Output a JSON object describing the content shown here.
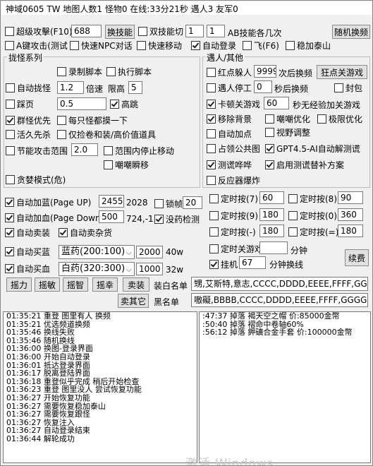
{
  "title": "神域0605 TW 地图人数1 怪物0 在线:33分21秒 遇人3 友军0",
  "top": {
    "super_attack": {
      "label": "超级攻擊(F10)",
      "checked": false,
      "value": "688"
    },
    "skill_btn": "换技能",
    "dual_skill": {
      "label": "双技能切",
      "checked": false,
      "v1": "1",
      "v2": "1"
    },
    "ab_label": "AB技能各几次",
    "random_btn": "随机换频",
    "a_key": {
      "label": "A键攻击(测试",
      "checked": false
    },
    "npc_talk": {
      "label": "快速NPC对话",
      "checked": false
    },
    "fast_move": {
      "label": "快速移动",
      "checked": false
    },
    "auto_login": {
      "label": "自动登录",
      "checked": true
    },
    "fly": {
      "label": "飞(F6)",
      "checked": false
    },
    "taishan": {
      "label": "稳加泰山",
      "checked": false
    }
  },
  "pickup": {
    "group_label": "拢怪系列",
    "record_script": {
      "label": "录制脚本",
      "checked": false
    },
    "run_script": {
      "label": "执行脚本",
      "checked": false
    },
    "auto_gather": {
      "label": "自动拢怪",
      "checked": false,
      "value": "1.2"
    },
    "multiplier": "倍速",
    "limit_high": "限高",
    "limit_value": "5",
    "stomp": {
      "label": "踩页",
      "checked": false,
      "value": "0.5"
    },
    "high_jump": {
      "label": "高跳",
      "checked": true
    },
    "group_first": {
      "label": "群怪优先",
      "checked": true
    },
    "touch_each": {
      "label": "每只怪都摸一下",
      "checked": false
    },
    "live_first": {
      "label": "活久先杀",
      "checked": false
    },
    "only_scroll": {
      "label": "仅捡卷和装/高价值道具",
      "checked": false
    },
    "energy_range": {
      "label": "节能攻击范围",
      "checked": false,
      "value": "2.0"
    },
    "stop_in_range": {
      "label": "范围内停止移动",
      "checked": false
    },
    "dodge": {
      "label": "嘲嘲瞬移",
      "checked": false
    },
    "greedy": {
      "label": "贪婪模式(危)",
      "checked": false
    }
  },
  "encounter": {
    "group_label": "遇人/其他",
    "red_dot": {
      "label": "红点躲人",
      "checked": false,
      "value": "9999"
    },
    "next_change": "次后换频",
    "crazy_btn": "狂点关游戏",
    "meet_stop": {
      "label": "遇人停工",
      "checked": false,
      "value": "0"
    },
    "sec_change": "秒后换频",
    "seal": {
      "label": "封包",
      "checked": false
    },
    "stuck_close": {
      "label": "卡顿关游戏",
      "checked": true,
      "value": "60"
    },
    "no_exp": "秒无经验加关游戏",
    "remove_bg": {
      "label": "移除背景",
      "checked": true
    },
    "dodge_opt": {
      "label": "嘲嘲优化",
      "checked": false
    },
    "extreme_opt": {
      "label": "极限优化",
      "checked": false
    },
    "auto_point": {
      "label": "自动加点",
      "checked": false
    },
    "view_adjust": {
      "label": "视野调整",
      "checked": false
    },
    "public_map": {
      "label": "占领公共图",
      "checked": false
    },
    "gpt": {
      "label": "GPT4.5-AI自动解测谎",
      "checked": true
    },
    "test_alarm": {
      "label": "测谎哗哗",
      "checked": true
    },
    "enable_patch": {
      "label": "启用测谎替补方案",
      "checked": true
    },
    "anti_ban": {
      "label": "反应器爆炸",
      "checked": false
    }
  },
  "auto": {
    "blue": {
      "label": "自动加蓝(Page UP)",
      "checked": true,
      "value": "2455",
      "extra": "2028"
    },
    "red": {
      "label": "自动加血(Page Down)",
      "checked": true,
      "value": "500",
      "extra": "724,-1"
    },
    "lock": {
      "label": "锁帧",
      "checked": false,
      "value": "20"
    },
    "no_check": {
      "label": "没药检测",
      "checked": true
    },
    "sell": {
      "label": "自动卖装",
      "checked": true
    },
    "sell_misc": {
      "label": "自动卖杂货",
      "checked": true
    },
    "buy_blue": {
      "label": "自动买蓝",
      "checked": true,
      "option": "蓝药(200:100)",
      "qty": "2000",
      "unit": "40w"
    },
    "buy_red": {
      "label": "自动买血",
      "checked": true,
      "option": "白药(320:300)",
      "qty": "1000",
      "unit": "32w"
    }
  },
  "timers": [
    {
      "label": "定时按(7)",
      "checked": false,
      "value": "60"
    },
    {
      "label": "定时按(8)",
      "checked": false,
      "value": "90"
    },
    {
      "label": "定时按(9)",
      "checked": false,
      "value": "180"
    },
    {
      "label": "定时按(0)",
      "checked": false,
      "value": "360"
    },
    {
      "label": "定时按(-)",
      "checked": false,
      "value": "180"
    },
    {
      "label": "定时按(=)",
      "checked": false,
      "value": "180"
    }
  ],
  "timed_close": {
    "label": "定时关游戏",
    "checked": false,
    "value": "",
    "unit": "分钟"
  },
  "hang": {
    "label": "挂机",
    "checked": true,
    "value": "67",
    "unit": "分钟换线"
  },
  "renew_btn": "续费",
  "action_btns": [
    "摇力",
    "摇敏",
    "摇智",
    "摇幸",
    "卖装"
  ],
  "white_label": "装白名单",
  "white_value": "甥,艾斯特,意志,CCCC,DDDD,EEEE,FFFF,GGGG,H",
  "sell_other_btn": "卖其它",
  "black_label": "黑名单",
  "black_value": "嗷礙,BBBB,CCCC,DDDD,EEEE,FFFF,GGGG,HHHH,I",
  "log_left": [
    "01:35:21 重登 图里有人 换频",
    "01:35:21 优选频道换频",
    "01:35:46 换线失败",
    "01:35:46 随机换线",
    "01:36:00 换图-登录界面",
    "01:36:00 开始自动登录",
    "01:36:01 抵达登录界面",
    "01:36:17 脱离登陆界面",
    "01:36:18 重登似乎完成 稍后开始检查",
    "01:36:23 重登 图里没人 尝试恢复功能",
    "01:36:27 开始恢复功能",
    "01:36:27 需要恢复稳加泰山",
    "01:36:27 需要恢复跟怪",
    "01:36:27 恢复注入",
    "01:36:27 自动登录结束",
    "01:36:44 解轮成功"
  ],
  "log_right": [
    ":47:37 掉落 褐天空之帽 价:85000金幣",
    ":50:40 掉落 褶命中卷轴60%",
    ":56:12 掉落 鉀礦合金手套 价:100000金幣"
  ],
  "watermark": "激活 Windows"
}
